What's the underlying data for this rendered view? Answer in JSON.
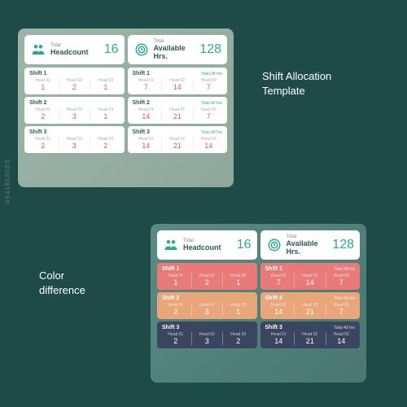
{
  "labels": {
    "title1_l1": "Shift Allocation",
    "title1_l2": "Template",
    "title2_l1": "Color",
    "title2_l2": "difference"
  },
  "summary": {
    "total_label": "Total",
    "headcount_label": "Headcount",
    "headcount_value": "16",
    "hrs_label": "Available Hrs.",
    "hrs_value": "128"
  },
  "left": {
    "s1": {
      "title": "Shift 1",
      "h1l": "Head 01",
      "h1v": "1",
      "h2l": "Head 02",
      "h2v": "2",
      "h3l": "Head 03",
      "h3v": "1"
    },
    "s2": {
      "title": "Shift 2",
      "h1l": "Head 01",
      "h1v": "2",
      "h2l": "Head 02",
      "h2v": "3",
      "h3l": "Head 03",
      "h3v": "1"
    },
    "s3": {
      "title": "Shift 3",
      "h1l": "Head 01",
      "h1v": "2",
      "h2l": "Head 02",
      "h2v": "3",
      "h3l": "Head 03",
      "h3v": "2"
    }
  },
  "right": {
    "s1": {
      "title": "Shift 1",
      "total": "Total 28 hrs",
      "h1l": "Head 01",
      "h1v": "7",
      "h2l": "Head 02",
      "h2v": "14",
      "h3l": "Head 03",
      "h3v": "7"
    },
    "s2": {
      "title": "Shift 2",
      "total": "Total 42 hrs",
      "h1l": "Head 01",
      "h1v": "14",
      "h2l": "Head 02",
      "h2v": "21",
      "h3l": "Head 03",
      "h3v": "7"
    },
    "s3": {
      "title": "Shift 3",
      "total": "Total 49 hrs",
      "h1l": "Head 01",
      "h1v": "14",
      "h2l": "Head 02",
      "h2v": "21",
      "h3l": "Head 03",
      "h3v": "14"
    }
  },
  "watermark": "#541858083"
}
